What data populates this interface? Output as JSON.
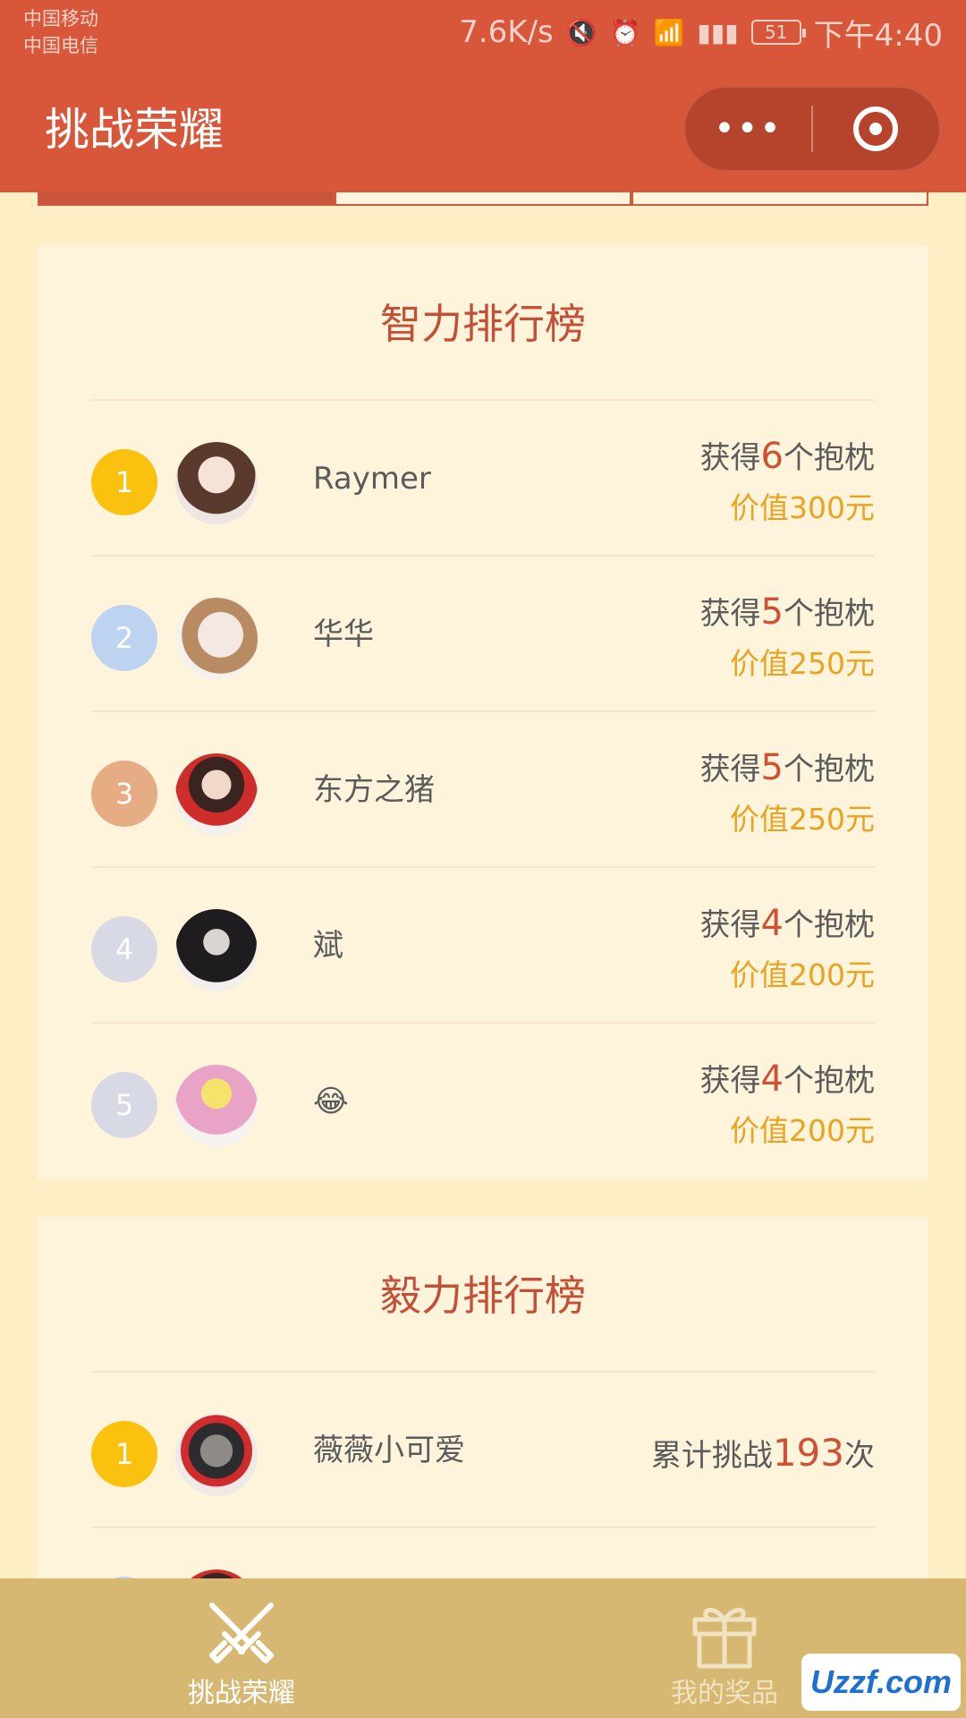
{
  "status_bar": {
    "carrier_1": "中国移动",
    "carrier_2": "中国电信",
    "speed": "7.6K/s",
    "battery": "51",
    "time": "下午4:40"
  },
  "header": {
    "title": "挑战荣耀",
    "more_label": "•••"
  },
  "intellect_board": {
    "title": "智力排行榜",
    "rows": [
      {
        "rank": "1",
        "name": "Raymer",
        "prefix": "获得",
        "count": "6",
        "suffix": "个抱枕",
        "value": "价值300元"
      },
      {
        "rank": "2",
        "name": "华华",
        "prefix": "获得",
        "count": "5",
        "suffix": "个抱枕",
        "value": "价值250元"
      },
      {
        "rank": "3",
        "name": "东方之猪",
        "prefix": "获得",
        "count": "5",
        "suffix": "个抱枕",
        "value": "价值250元"
      },
      {
        "rank": "4",
        "name": "斌",
        "prefix": "获得",
        "count": "4",
        "suffix": "个抱枕",
        "value": "价值200元"
      },
      {
        "rank": "5",
        "name": "😂",
        "prefix": "获得",
        "count": "4",
        "suffix": "个抱枕",
        "value": "价值200元"
      }
    ]
  },
  "perseverance_board": {
    "title": "毅力排行榜",
    "rows": [
      {
        "rank": "1",
        "name": "薇薇小可爱",
        "prefix": "累计挑战",
        "count": "193",
        "suffix": "次"
      }
    ]
  },
  "tab_bar": {
    "items": [
      {
        "label": "挑战荣耀",
        "icon": "crossed-swords-icon",
        "active": true
      },
      {
        "label": "我的奖品",
        "icon": "gift-icon",
        "active": false
      }
    ]
  },
  "watermark": "Uzzf.com",
  "colors": {
    "brand": "#d8563a",
    "page_bg": "#fdeec5",
    "card_bg": "#fef4dc",
    "highlight": "#cf5133",
    "value_text": "#eaa321",
    "tab_bar": "#d7b872"
  }
}
